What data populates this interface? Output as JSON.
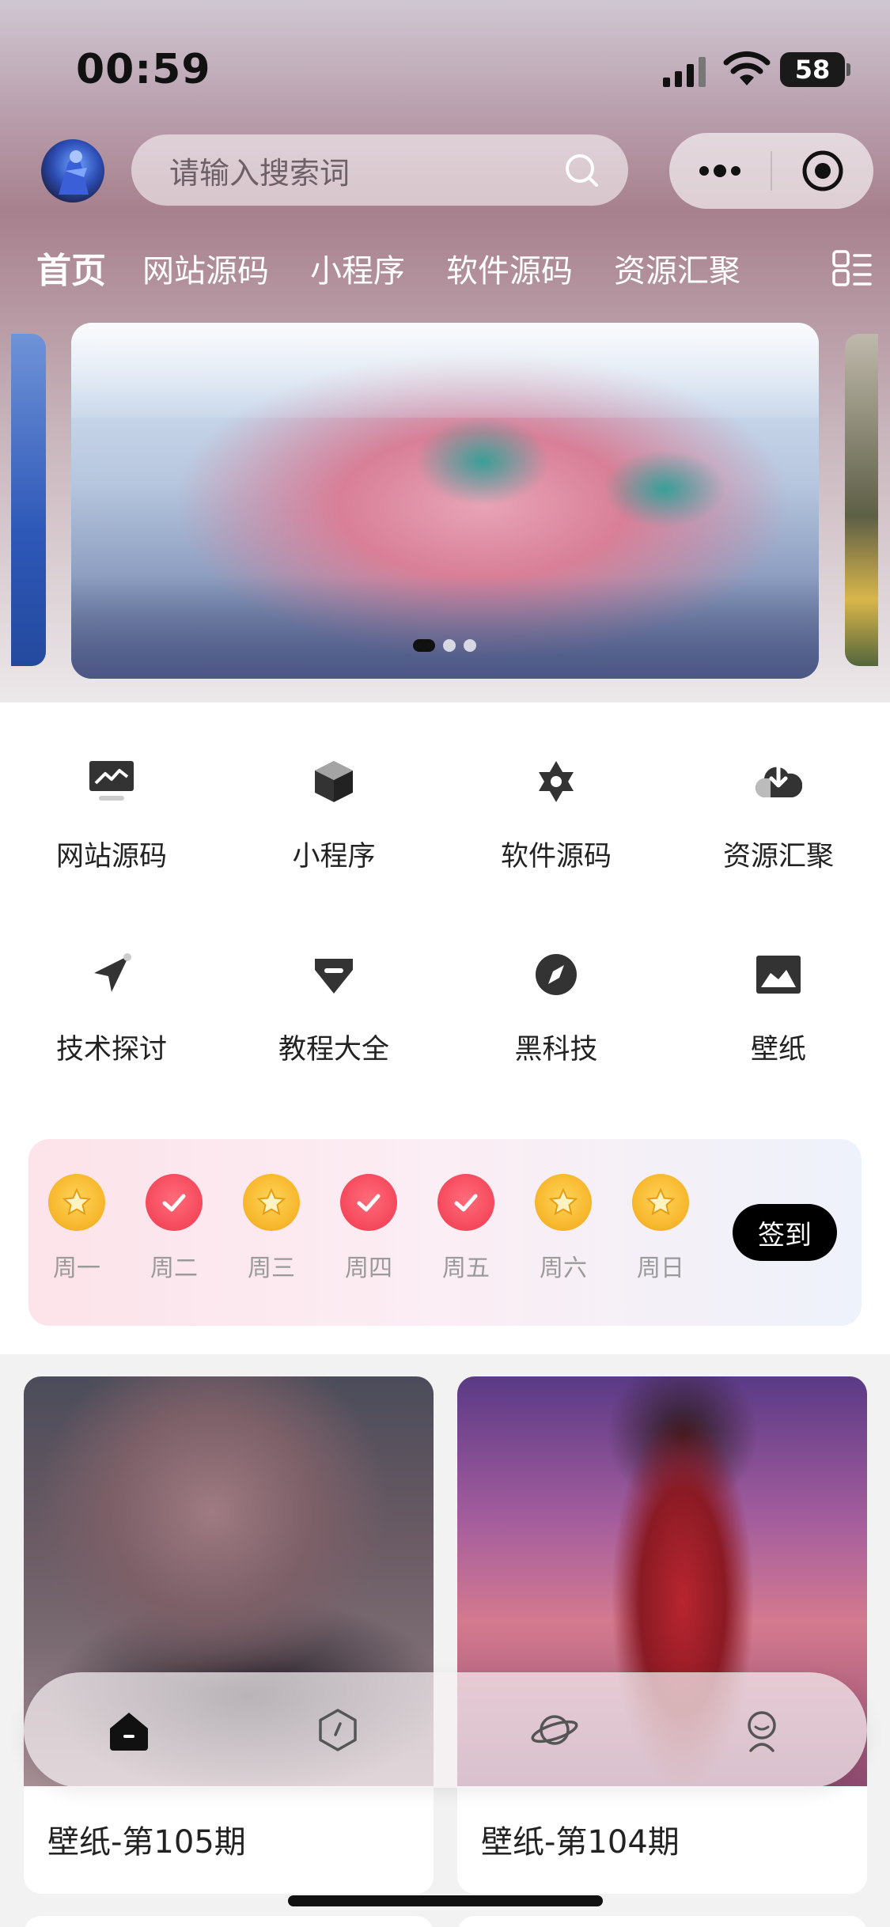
{
  "status_bar": {
    "time": "00:59",
    "battery": "58"
  },
  "header": {
    "search_placeholder": "请输入搜索词",
    "tabs": [
      "首页",
      "网站源码",
      "小程序",
      "软件源码",
      "资源汇聚"
    ],
    "active_tab": "首页"
  },
  "banner": {
    "dots": 3,
    "active_dot": 0
  },
  "categories": [
    {
      "label": "网站源码",
      "icon": "monitor-chart-icon"
    },
    {
      "label": "小程序",
      "icon": "cube-icon"
    },
    {
      "label": "软件源码",
      "icon": "hexagram-icon"
    },
    {
      "label": "资源汇聚",
      "icon": "cloud-download-icon"
    },
    {
      "label": "技术探讨",
      "icon": "paper-plane-icon"
    },
    {
      "label": "教程大全",
      "icon": "diamond-icon"
    },
    {
      "label": "黑科技",
      "icon": "compass-icon"
    },
    {
      "label": "壁纸",
      "icon": "image-icon"
    }
  ],
  "sign_in": {
    "days": [
      {
        "label": "周一",
        "state": "star"
      },
      {
        "label": "周二",
        "state": "done"
      },
      {
        "label": "周三",
        "state": "star"
      },
      {
        "label": "周四",
        "state": "done"
      },
      {
        "label": "周五",
        "state": "done"
      },
      {
        "label": "周六",
        "state": "star"
      },
      {
        "label": "周日",
        "state": "star"
      }
    ],
    "button": "签到"
  },
  "cards": [
    {
      "title": "壁纸-第105期"
    },
    {
      "title": "壁纸-第104期"
    }
  ],
  "bottom_nav": [
    {
      "icon": "home-icon",
      "active": true
    },
    {
      "icon": "hexagon-icon",
      "active": false
    },
    {
      "icon": "planet-icon",
      "active": false
    },
    {
      "icon": "user-icon",
      "active": false
    }
  ],
  "colors": {
    "accent_red": "#f0384d",
    "star_gold": "#f7b72c",
    "sign_button": "#000000"
  }
}
